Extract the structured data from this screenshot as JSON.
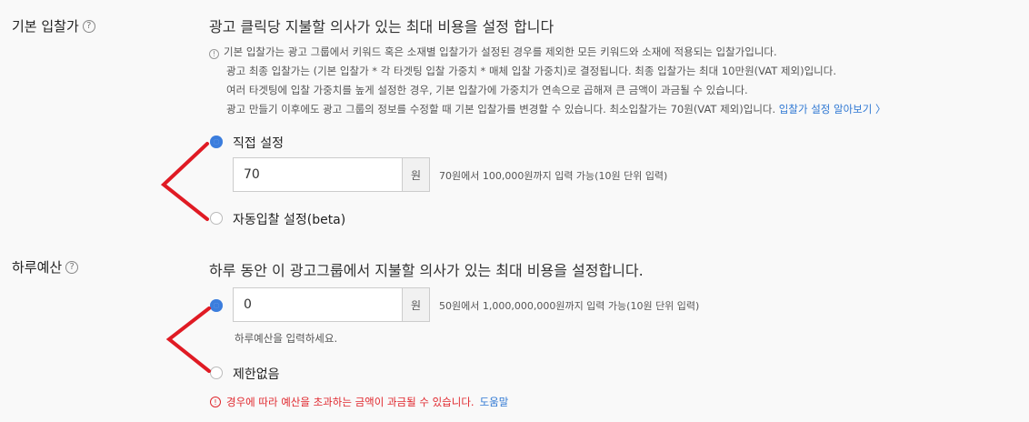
{
  "bid": {
    "label": "기본 입찰가",
    "help": "?",
    "heading": "광고 클릭당 지불할 의사가 있는 최대 비용을 설정 합니다",
    "info_icon": "!",
    "info_lines": [
      "기본 입찰가는 광고 그룹에서 키워드 혹은 소재별 입찰가가 설정된 경우를 제외한 모든 키워드와 소재에 적용되는 입찰가입니다.",
      "광고 최종 입찰가는 (기본 입찰가 * 각 타겟팅 입찰 가중치 * 매체 입찰 가중치)로 결정됩니다. 최종 입찰가는 최대 10만원(VAT 제외)입니다.",
      "여러 타겟팅에 입찰 가중치를 높게 설정한 경우, 기본 입찰가에 가중치가 연속으로 곱해져 큰 금액이 과금될 수 있습니다.",
      "광고 만들기 이후에도 광고 그룹의 정보를 수정할 때 기본 입찰가를 변경할 수 있습니다. 최소입찰가는 70원(VAT 제외)입니다."
    ],
    "info_link": "입찰가 설정 알아보기 〉",
    "option_manual": "직접 설정",
    "value": "70",
    "unit": "원",
    "hint": "70원에서 100,000원까지 입력 가능(10원 단위 입력)",
    "option_auto": "자동입찰 설정(beta)"
  },
  "budget": {
    "label": "하루예산",
    "help": "?",
    "heading": "하루 동안 이 광고그룹에서 지불할 의사가 있는 최대 비용을 설정합니다.",
    "value": "0",
    "unit": "원",
    "hint": "50원에서 1,000,000,000원까지 입력 가능(10원 단위 입력)",
    "placeholder_hint": "하루예산을 입력하세요.",
    "option_unlimited": "제한없음",
    "warning_icon": "!",
    "warning": "경우에 따라 예산을 초과하는 금액이 과금될 수 있습니다.",
    "warning_link": "도움말"
  },
  "colors": {
    "accent": "#3b7ddd",
    "annotation": "#e01b24",
    "warning": "#e0282e",
    "link": "#2f78d3"
  }
}
